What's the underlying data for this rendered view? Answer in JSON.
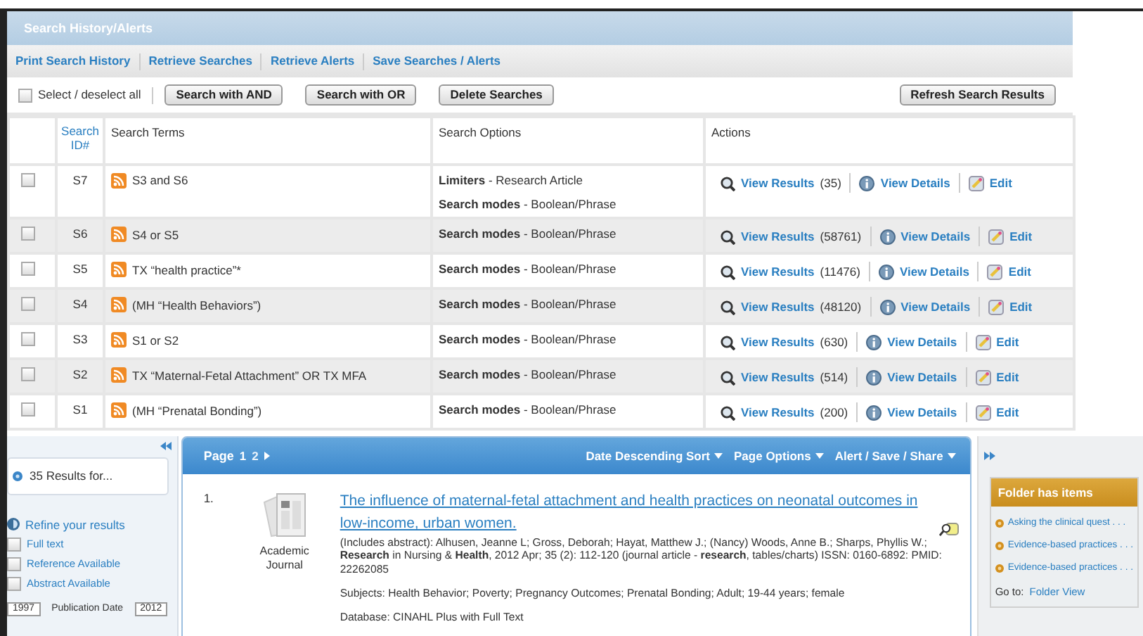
{
  "panel_title": "Search History/Alerts",
  "links": [
    "Print Search History",
    "Retrieve Searches",
    "Retrieve Alerts",
    "Save Searches / Alerts"
  ],
  "toolbar": {
    "select_all": {
      "label": "Select / deselect all",
      "checked": false
    },
    "buttons": [
      "Search with AND",
      "Search with OR",
      "Delete Searches"
    ],
    "refresh_button": "Refresh Search Results"
  },
  "table": {
    "columns": [
      "Search ID#",
      "Search Terms",
      "Search Options",
      "Actions"
    ],
    "rows": [
      {
        "id": "S7",
        "checked": false,
        "terms": "S3 and S6",
        "options": [
          {
            "label": "Limiters",
            "value": "- Research Article"
          },
          {
            "label": "Search modes",
            "value": "- Boolean/Phrase"
          }
        ],
        "view_results": "View Results",
        "count": "(35)",
        "view_details": "View Details",
        "edit": "Edit"
      },
      {
        "id": "S6",
        "checked": false,
        "terms": "S4 or S5",
        "options": [
          {
            "label": "Search modes",
            "value": "- Boolean/Phrase"
          }
        ],
        "view_results": "View Results",
        "count": "(58761)",
        "view_details": "View Details",
        "edit": "Edit"
      },
      {
        "id": "S5",
        "checked": false,
        "terms": "TX “health practice”*",
        "options": [
          {
            "label": "Search modes",
            "value": "- Boolean/Phrase"
          }
        ],
        "view_results": "View Results",
        "count": "(11476)",
        "view_details": "View Details",
        "edit": "Edit"
      },
      {
        "id": "S4",
        "checked": false,
        "terms": "(MH “Health Behaviors”)",
        "options": [
          {
            "label": "Search modes",
            "value": "- Boolean/Phrase"
          }
        ],
        "view_results": "View Results",
        "count": "(48120)",
        "view_details": "View Details",
        "edit": "Edit"
      },
      {
        "id": "S3",
        "checked": false,
        "terms": "S1 or S2",
        "options": [
          {
            "label": "Search modes",
            "value": "- Boolean/Phrase"
          }
        ],
        "view_results": "View Results",
        "count": "(630)",
        "view_details": "View Details",
        "edit": "Edit"
      },
      {
        "id": "S2",
        "checked": false,
        "terms": "TX “Maternal-Fetal Attachment” OR TX MFA",
        "options": [
          {
            "label": "Search modes",
            "value": "- Boolean/Phrase"
          }
        ],
        "view_results": "View Results",
        "count": "(514)",
        "view_details": "View Details",
        "edit": "Edit"
      },
      {
        "id": "S1",
        "checked": false,
        "terms": "(MH “Prenatal Bonding”)",
        "options": [
          {
            "label": "Search modes",
            "value": "- Boolean/Phrase"
          }
        ],
        "view_results": "View Results",
        "count": "(200)",
        "view_details": "View Details",
        "edit": "Edit"
      }
    ]
  },
  "sidebar": {
    "results_for": "35 Results for...",
    "refine": "Refine your results",
    "facets": [
      {
        "label": "Full text",
        "checked": false
      },
      {
        "label": "Reference Available",
        "checked": false
      },
      {
        "label": "Abstract Available",
        "checked": false
      }
    ],
    "date": {
      "from": "1997",
      "label": "Publication Date",
      "to": "2012"
    }
  },
  "results": {
    "page_label": "Page",
    "pages": [
      {
        "label": "1",
        "selected": true
      },
      {
        "label": "2",
        "selected": false
      }
    ],
    "menus": [
      "Date Descending Sort",
      "Page Options",
      "Alert / Save / Share"
    ],
    "items": [
      {
        "number": "1.",
        "type": "Academic Journal",
        "title": "The influence of maternal-fetal attachment and health practices on neonatal outcomes in low-income, urban women.",
        "citation": "(Includes abstract): Alhusen, Jeanne L; Gross, Deborah; Hayat, Matthew J.; (Nancy) Woods, Anne B.; Sharps, Phyllis W.; **Research** in Nursing & **Health**, 2012 Apr; 35 (2): 112-120 (journal article - **research**, tables/charts) ISSN: 0160-6892: PMID: 22262085",
        "subjects": "Subjects: Health Behavior; Poverty; Pregnancy Outcomes; Prenatal Bonding; Adult; 19-44 years; female",
        "database": "Database: CINAHL Plus with Full Text"
      }
    ]
  },
  "folder": {
    "title": "Folder has items",
    "items": [
      "Asking the clinical quest . . .",
      "Evidence-based practices . . .",
      "Evidence-based practices . . ."
    ],
    "goto_label": "Go to:",
    "goto_link": "Folder View"
  }
}
